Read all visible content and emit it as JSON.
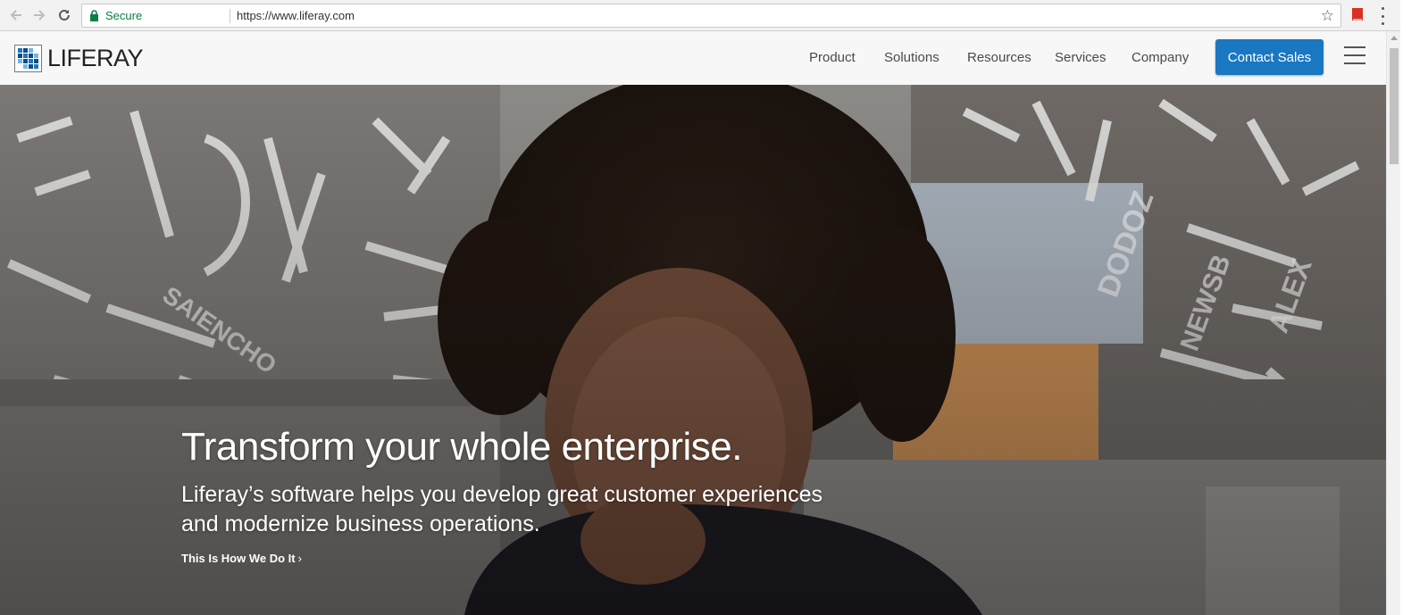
{
  "browser": {
    "secure_label": "Secure",
    "url": "https://www.liferay.com",
    "icons": [
      "back-icon",
      "forward-icon",
      "reload-icon",
      "lock-icon",
      "star-icon",
      "extension-icon",
      "menu-icon"
    ]
  },
  "header": {
    "logo_text": "LIFERAY",
    "nav": [
      "Product",
      "Solutions",
      "Resources",
      "Services",
      "Company"
    ],
    "cta_label": "Contact Sales"
  },
  "hero": {
    "title": "Transform your whole enterprise.",
    "subtitle": "Liferay’s software helps you develop great customer experiences and modernize business operations.",
    "link_label": "This Is How We Do It",
    "link_chevron": "›"
  },
  "colors": {
    "cta": "#1a77c1",
    "secure": "#0b8043",
    "logo_blue": "#1a77c1"
  }
}
